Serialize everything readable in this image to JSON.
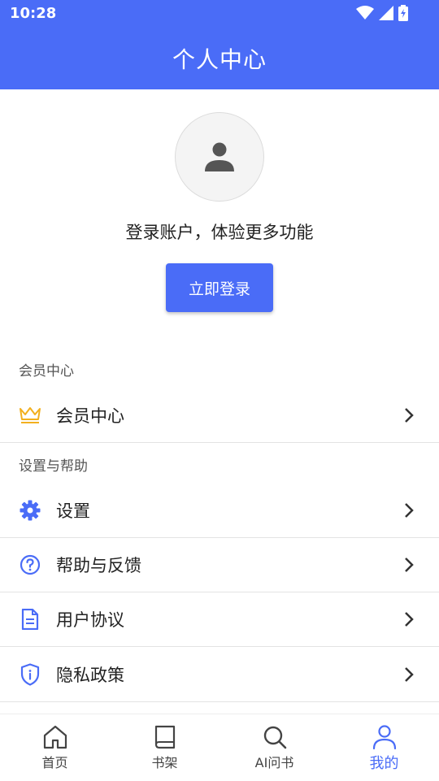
{
  "status_bar": {
    "time": "10:28"
  },
  "header": {
    "title": "个人中心"
  },
  "profile": {
    "tip": "登录账户，体验更多功能",
    "login_button": "立即登录"
  },
  "sections": [
    {
      "title": "会员中心"
    },
    {
      "title": "设置与帮助"
    }
  ],
  "menu": {
    "vip": {
      "label": "会员中心",
      "icon": "crown-icon"
    },
    "settings": {
      "label": "设置",
      "icon": "gear-icon"
    },
    "help": {
      "label": "帮助与反馈",
      "icon": "question-circle-icon"
    },
    "agreement": {
      "label": "用户协议",
      "icon": "document-icon"
    },
    "privacy": {
      "label": "隐私政策",
      "icon": "shield-icon"
    }
  },
  "tabs": [
    {
      "label": "首页",
      "icon": "home-icon"
    },
    {
      "label": "书架",
      "icon": "book-icon"
    },
    {
      "label": "AI问书",
      "icon": "search-icon"
    },
    {
      "label": "我的",
      "icon": "person-icon",
      "active": true
    }
  ],
  "colors": {
    "primary": "#4A6CF7",
    "crown": "#F2B01E",
    "divider": "#E3E3E3"
  }
}
